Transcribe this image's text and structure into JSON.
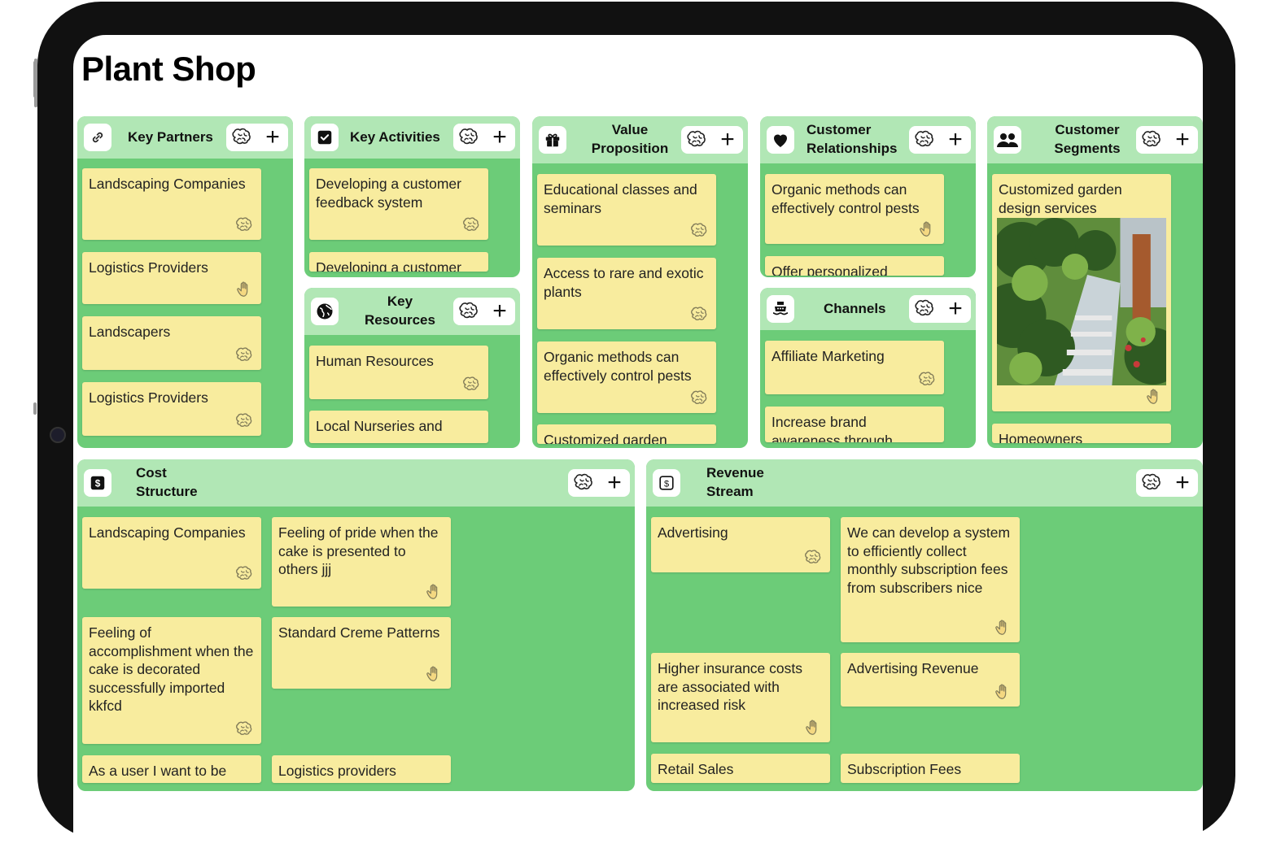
{
  "app": {
    "title": "Plant Shop"
  },
  "sections": {
    "key_partners": {
      "title": "Key Partners",
      "icon": "link-icon",
      "cards": [
        "Landscaping Companies",
        "Logistics Providers",
        "Landscapers",
        "Logistics Providers"
      ]
    },
    "key_activities": {
      "title": "Key Activities",
      "icon": "checkbox-icon",
      "cards": [
        "Developing a customer feedback system",
        "Developing a customer"
      ]
    },
    "key_resources": {
      "title": "Key Resources",
      "icon": "globe-icon",
      "cards": [
        "Human Resources",
        "Local Nurseries and"
      ]
    },
    "value_proposition": {
      "title": "Value Proposition",
      "icon": "gift-icon",
      "cards": [
        "Educational classes and seminars",
        "Access to rare and exotic plants",
        "Organic methods can effectively control pests",
        "Customized garden"
      ]
    },
    "customer_relationships": {
      "title": "Customer Relationships",
      "icon": "heart-icon",
      "cards": [
        "Organic methods can effectively control pests",
        "Offer personalized"
      ]
    },
    "channels": {
      "title": "Channels",
      "icon": "ship-icon",
      "cards": [
        "Affiliate Marketing",
        "Increase brand awareness through"
      ]
    },
    "customer_segments": {
      "title": "Customer Segments",
      "icon": "people-icon",
      "cards": [
        "Customized garden design services",
        "Homeowners"
      ]
    },
    "cost_structure": {
      "title": "Cost Structure",
      "icon": "dollar-icon",
      "cards": [
        "Landscaping Companies",
        "Feeling of pride when the cake is presented to others jjj",
        "Feeling of accomplishment when the cake is decorated successfully imported kkfcd",
        "Standard Creme Patterns",
        "As a user I want to be",
        "Logistics providers"
      ]
    },
    "revenue_stream": {
      "title": "Revenue Stream",
      "icon": "dollar-outline-icon",
      "cards": [
        "Advertising",
        "We can develop a system to efficiently collect monthly subscription fees from subscribers nice",
        "Higher insurance costs are associated with increased risk",
        "Advertising Revenue",
        "Retail Sales",
        "Subscription Fees"
      ]
    }
  },
  "colors": {
    "section_bg": "#6ccc78",
    "header_bg": "#b1e7b5",
    "card_bg": "#f8ec9e"
  }
}
